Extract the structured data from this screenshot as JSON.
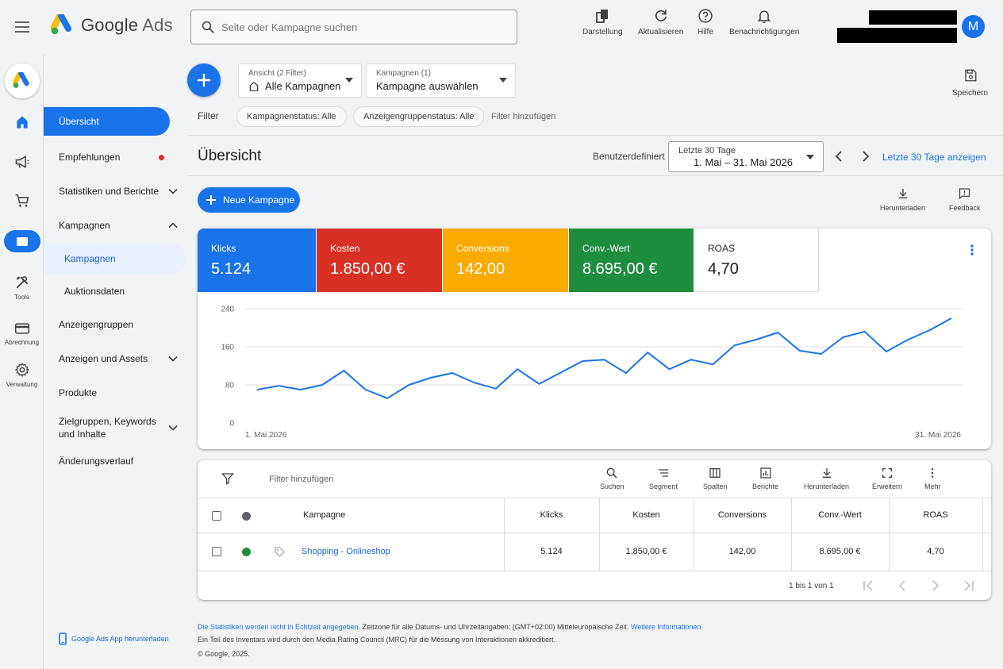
{
  "app": {
    "brand_google": "Google",
    "brand_ads": "Ads"
  },
  "search": {
    "placeholder": "Seite oder Kampagne suchen"
  },
  "toolbar": {
    "appearance": "Darstellung",
    "refresh": "Aktualisieren",
    "help": "Hilfe",
    "notifications": "Benachrichtigungen"
  },
  "user": {
    "initial": "M"
  },
  "rail": {
    "tools": "Tools",
    "billing": "Abrechnung",
    "admin": "Verwaltung"
  },
  "nav": {
    "overview": "Übersicht",
    "recommendations": "Empfehlungen",
    "insights": "Statistiken und Berichte",
    "campaigns": "Kampagnen",
    "campaigns_sub": "Kampagnen",
    "auction": "Auktionsdaten",
    "adgroups": "Anzeigengruppen",
    "ads": "Anzeigen und Assets",
    "products": "Produkte",
    "audiences": "Zielgruppen, Keywords und Inhalte",
    "history": "Änderungsverlauf",
    "app_download": "Google Ads App herunterladen"
  },
  "view_picker": {
    "caption": "Ansicht (2 Filter)",
    "value": "Alle Kampagnen"
  },
  "campaign_picker": {
    "caption": "Kampagnen (1)",
    "value": "Kampagne auswählen"
  },
  "save": "Speichern",
  "filters": {
    "label": "Filter",
    "chip1": "Kampagnenstatus: Alle",
    "chip2": "Anzeigengruppenstatus: Alle",
    "add": "Filter hinzufügen"
  },
  "header": {
    "title": "Übersicht",
    "custom": "Benutzerdefiniert",
    "date_caption": "Letzte 30 Tage",
    "date_range": "1. Mai – 31. Mai 2026",
    "show_last": "Letzte 30 Tage anzeigen"
  },
  "actions": {
    "new_campaign": "Neue Kampagne",
    "download": "Herunterladen",
    "feedback": "Feedback"
  },
  "metrics": [
    {
      "label": "Klicks",
      "value": "5.124",
      "color": "#1a73e8"
    },
    {
      "label": "Kosten",
      "value": "1.850,00 €",
      "color": "#d93025"
    },
    {
      "label": "Conversions",
      "value": "142,00",
      "color": "#f9ab00"
    },
    {
      "label": "Conv.-Wert",
      "value": "8.695,00 €",
      "color": "#1e8e3e"
    },
    {
      "label": "ROAS",
      "value": "4,70",
      "color": "#ffffff"
    }
  ],
  "chart_data": {
    "type": "line",
    "x_start": "1. Mai 2026",
    "x_end": "31. Mai 2026",
    "yticks": [
      "240",
      "160",
      "80",
      "0"
    ],
    "ylim": [
      0,
      240
    ],
    "grid": true,
    "color": "#1a73e8",
    "series": [
      {
        "values": [
          70,
          78,
          70,
          80,
          110,
          70,
          52,
          80,
          95,
          105,
          85,
          72,
          113,
          82,
          106,
          130,
          133,
          105,
          148,
          113,
          133,
          123,
          163,
          175,
          190,
          152,
          145,
          180,
          192,
          150,
          175,
          195,
          220
        ]
      }
    ]
  },
  "table_tools": {
    "filter_add": "Filter hinzufügen",
    "search": "Suchen",
    "segment": "Segment",
    "columns": "Spalten",
    "reports": "Berichte",
    "download": "Herunterladen",
    "expand": "Erweitern",
    "more": "Mehr"
  },
  "table": {
    "headers": [
      "Kampagne",
      "Klicks",
      "Kosten",
      "Conversions",
      "Conv.-Wert",
      "ROAS"
    ],
    "row": {
      "name": "Shopping - Onlineshop",
      "clicks": "5.124",
      "cost": "1.850,00 €",
      "conversions": "142,00",
      "value": "8.695,00 €",
      "roas": "4,70",
      "status_color": "#1e8e3e"
    },
    "pagination": "1 bis 1 von 1"
  },
  "footer": {
    "line1_link": "Die Statistiken werden nicht in Echtzeit angegeben.",
    "line1_text": "Zeitzone für alle Datums- und Uhrzeitangaben: (GMT+02:00) Mitteleuropäische Zeit.",
    "line1_more": "Weitere Informationen",
    "line2": "Ein Teil des Inventars wird durch den Media Rating Council (MRC) für die Messung von Interaktionen akkreditiert.",
    "line3": "© Google, 2025."
  }
}
